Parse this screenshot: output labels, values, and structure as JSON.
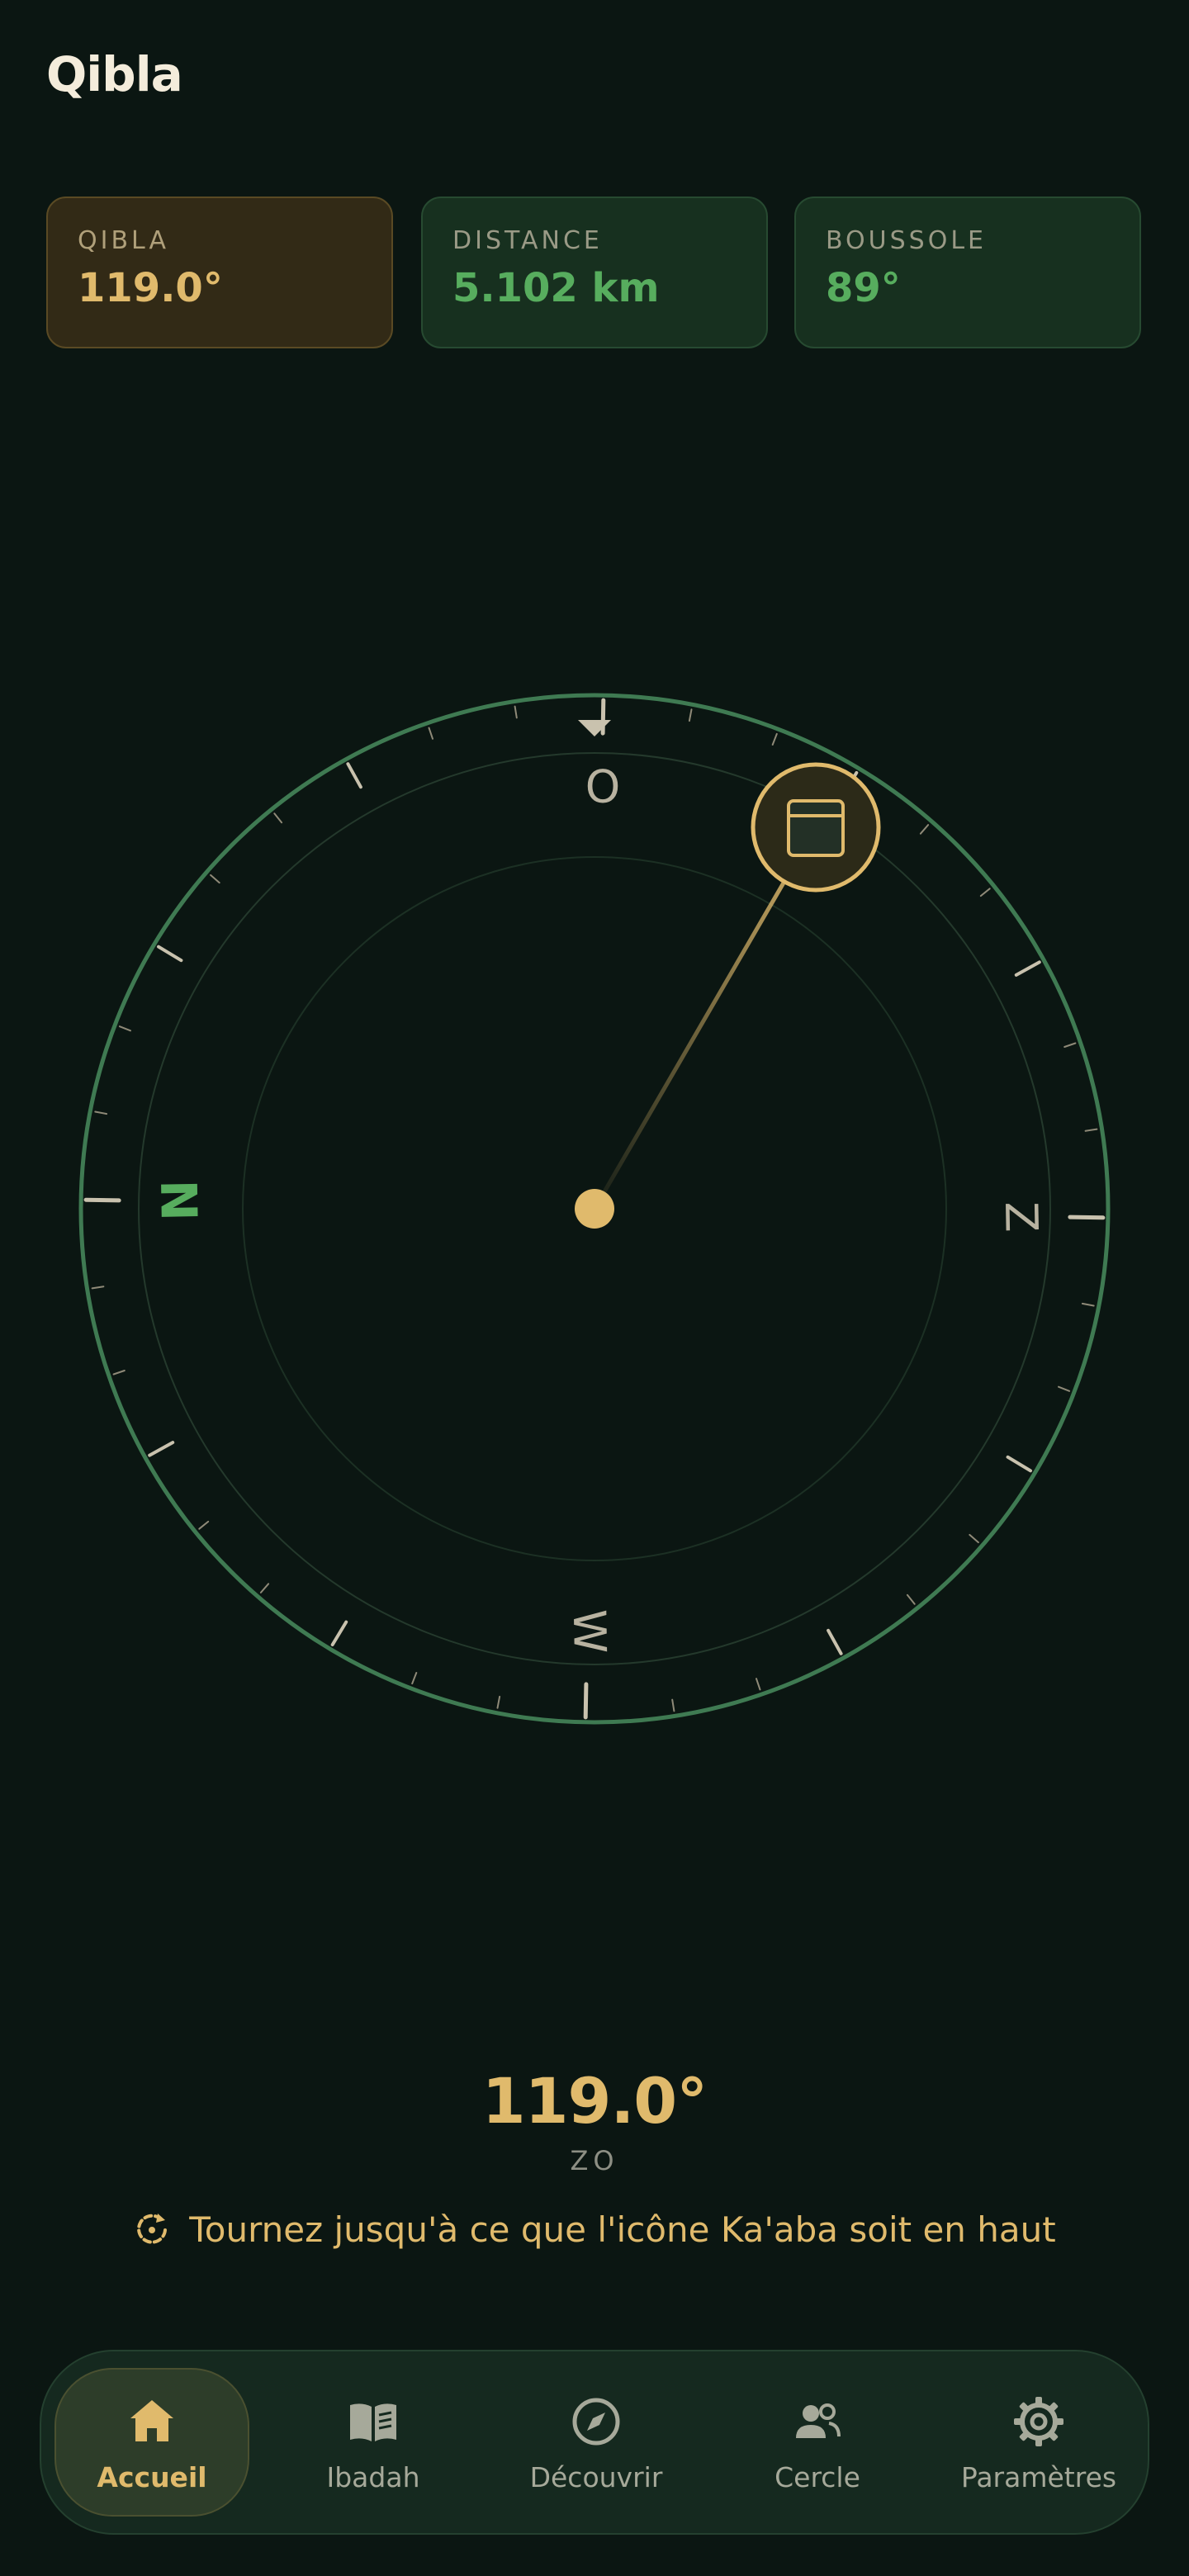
{
  "header": {
    "title": "Qibla"
  },
  "stats": {
    "qibla": {
      "label": "QIBLA",
      "value": "119.0°"
    },
    "distance": {
      "label": "DISTANCE",
      "value": "5.102 km"
    },
    "compass": {
      "label": "BOUSSOLE",
      "value": "89°"
    }
  },
  "compass": {
    "qibla_bearing_deg": 119.0,
    "heading_deg": 89,
    "cardinals": {
      "north": "N",
      "east": "O",
      "south": "Z",
      "west": "W"
    },
    "colors": {
      "ring": "#3f7a52",
      "north": "#57ad5e",
      "gold": "#e0ba6c",
      "tick": "#c9c2ae"
    },
    "kaaba_icon": "kaaba-icon"
  },
  "readout": {
    "angle": "119.0°",
    "direction": "ZO",
    "hint": "Tournez jusqu'à ce que l'icône Ka'aba soit en haut",
    "hint_icon": "rotate-icon"
  },
  "nav": {
    "items": [
      {
        "label": "Accueil",
        "icon": "home-icon",
        "active": true
      },
      {
        "label": "Ibadah",
        "icon": "book-icon",
        "active": false
      },
      {
        "label": "Découvrir",
        "icon": "compass-icon",
        "active": false
      },
      {
        "label": "Cercle",
        "icon": "people-icon",
        "active": false
      },
      {
        "label": "Paramètres",
        "icon": "gear-icon",
        "active": false
      }
    ]
  }
}
